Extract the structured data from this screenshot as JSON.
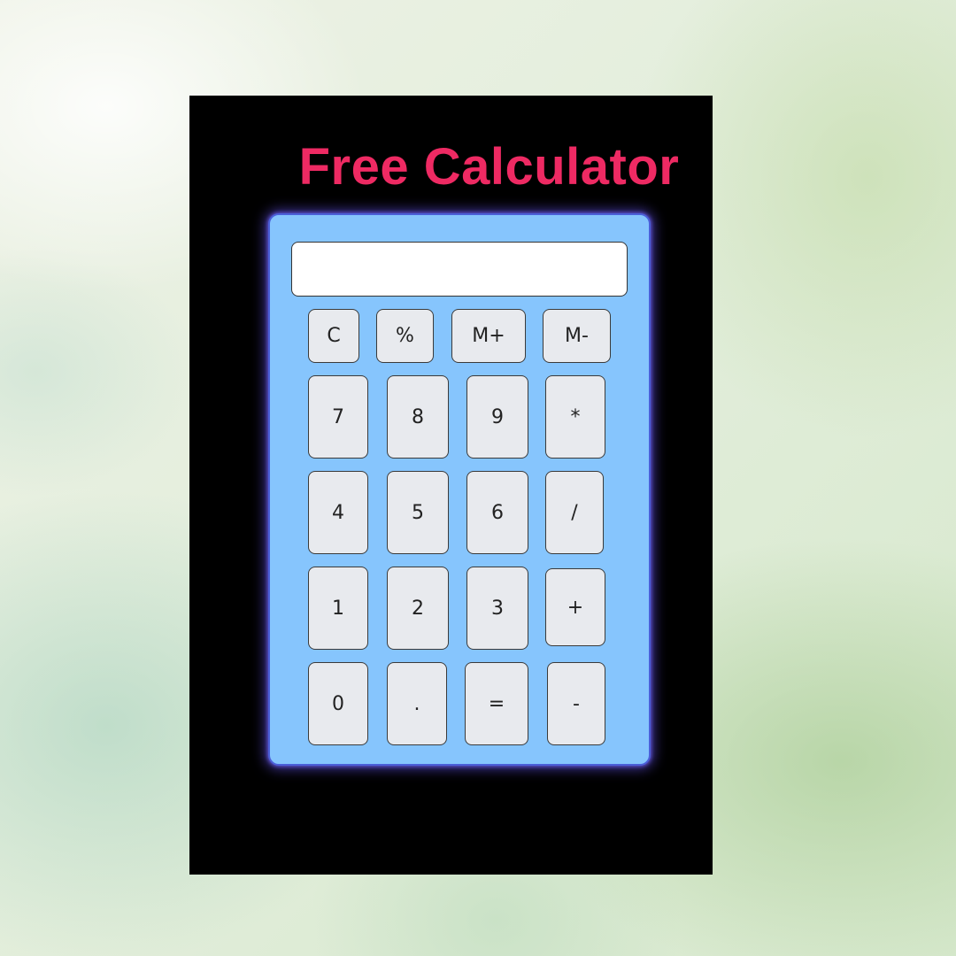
{
  "title": "Free Calculator",
  "display": {
    "value": ""
  },
  "keys": {
    "clear": "C",
    "percent": "%",
    "memory_plus": "M+",
    "memory_minus": "M-",
    "seven": "7",
    "eight": "8",
    "nine": "9",
    "multiply": "*",
    "four": "4",
    "five": "5",
    "six": "6",
    "divide": "/",
    "one": "1",
    "two": "2",
    "three": "3",
    "add": "+",
    "zero": "0",
    "decimal": ".",
    "equals": "=",
    "subtract": "-"
  },
  "colors": {
    "title": "#ee2a63",
    "calculator_body": "#86c5fd",
    "poster_background": "#000000",
    "key_face": "#e8eaee",
    "glow": "#6e5aff"
  }
}
